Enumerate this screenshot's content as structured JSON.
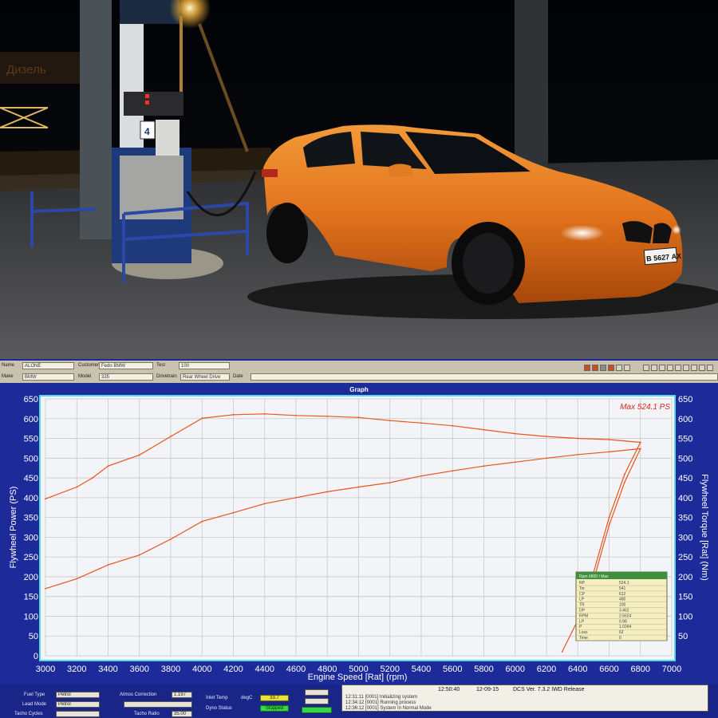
{
  "photo": {
    "plate": "В 5627 АХ",
    "sign_text": "Дизель",
    "pump_number": "4"
  },
  "header": {
    "row1": [
      {
        "label": "Name",
        "value": "ALONE"
      },
      {
        "label": "Customer",
        "value": "Fedo BMW"
      },
      {
        "label": "Test",
        "value": "100"
      }
    ],
    "row2": [
      {
        "label": "Make",
        "value": "BMW"
      },
      {
        "label": "Model",
        "value": "335"
      },
      {
        "label": "Drivetrain",
        "value": "Rear Wheel Drive"
      },
      {
        "label": "Date",
        "value": ""
      }
    ]
  },
  "graph": {
    "window_title": "Graph",
    "max_label": "Max 524.1 PS"
  },
  "chart_data": {
    "type": "line",
    "title": "",
    "xlabel": "Engine Speed [Rat] (rpm)",
    "ylabel": "Flywheel Power (PS)",
    "y2label": "Flywheel Torque [Rat] (Nm)",
    "xlim": [
      3000,
      7000
    ],
    "ylim": [
      0,
      650
    ],
    "y2lim": [
      0,
      650
    ],
    "xticks": [
      3000,
      3200,
      3400,
      3600,
      3800,
      4000,
      4200,
      4400,
      4600,
      4800,
      5000,
      5200,
      5400,
      5600,
      5800,
      6000,
      6200,
      6400,
      6600,
      6800,
      7000
    ],
    "yticks": [
      0,
      50,
      100,
      150,
      200,
      250,
      300,
      350,
      400,
      450,
      500,
      550,
      600,
      650
    ],
    "y2ticks": [
      50,
      100,
      150,
      200,
      250,
      300,
      350,
      400,
      450,
      500,
      550,
      600,
      650
    ],
    "grid": true,
    "series": [
      {
        "name": "",
        "axis": "right",
        "color": "#e8541e",
        "x": [
          3000,
          3200,
          3300,
          3400,
          3600,
          3800,
          4000,
          4200,
          4400,
          4600,
          4800,
          5000,
          5200,
          5400,
          5600,
          5800,
          6000,
          6200,
          6400,
          6600,
          6800
        ],
        "y": [
          397,
          427,
          450,
          480,
          508,
          555,
          601,
          610,
          612,
          608,
          606,
          603,
          595,
          589,
          582,
          572,
          562,
          555,
          550,
          547,
          540
        ]
      },
      {
        "name": "",
        "axis": "left",
        "color": "#e8541e",
        "x": [
          3000,
          3200,
          3400,
          3600,
          3800,
          4000,
          4200,
          4400,
          4600,
          4800,
          5000,
          5200,
          5400,
          5600,
          5800,
          6000,
          6200,
          6400,
          6600,
          6800
        ],
        "y": [
          170,
          195,
          230,
          255,
          295,
          340,
          362,
          385,
          400,
          415,
          427,
          438,
          455,
          468,
          480,
          490,
          500,
          509,
          516,
          524
        ]
      },
      {
        "name": "",
        "axis": "right",
        "color": "#e8541e",
        "x": [
          6800,
          6700,
          6600,
          6500,
          6400,
          6300
        ],
        "y": [
          540,
          460,
          350,
          210,
          90,
          10
        ]
      },
      {
        "name": "",
        "axis": "left",
        "color": "#e8541e",
        "x": [
          6800,
          6700,
          6600,
          6500,
          6420
        ],
        "y": [
          524,
          440,
          330,
          190,
          120
        ]
      }
    ]
  },
  "info_box": {
    "title": "Rpm 6800 / Max",
    "rows": [
      {
        "k": "RP",
        "v": "524.1"
      },
      {
        "k": "Tor",
        "v": "541"
      },
      {
        "k": "CP",
        "v": "612"
      },
      {
        "k": "LP",
        "v": "480"
      },
      {
        "k": "TR",
        "v": "100"
      },
      {
        "k": "DP",
        "v": "3.462"
      },
      {
        "k": "RPM",
        "v": "2.5624"
      },
      {
        "k": "LP",
        "v": "0.98"
      },
      {
        "k": "P",
        "v": "1.0264"
      },
      {
        "k": "Loss",
        "v": "62"
      },
      {
        "k": "Time",
        "v": "0"
      }
    ]
  },
  "bottom": {
    "fuel_type_label": "Fuel Type",
    "fuel_type_value": "Petrol",
    "lead_mode_label": "Lead Mode",
    "lead_mode_value": "Petrol",
    "tacho_cycles_label": "Tacho Cycles",
    "tacho_cycles_value": "",
    "atmos_label": "Atmos Correction",
    "atmos_value": "1.197",
    "tacho_ratio_label": "Tacho Ratio",
    "tacho_ratio_value": "35.00",
    "inlet_temp_label": "Inlet Temp",
    "inlet_temp_unit": "degC",
    "inlet_temp_value": "33.7",
    "dyno_status_label": "Dyno Status",
    "dyno_status_value": "Stopped",
    "btn1": "",
    "btn2": "",
    "btn3": "",
    "time": "12:50:40",
    "date": "12-09-15",
    "version": "DCS Ver. 7.3.2 IWD Release",
    "log1": "12:31:11 [0001] Initializing system",
    "log2": "12:34:12 [0001] Running process",
    "log3": "12:36:12 [0001] System In Normal Mode"
  }
}
